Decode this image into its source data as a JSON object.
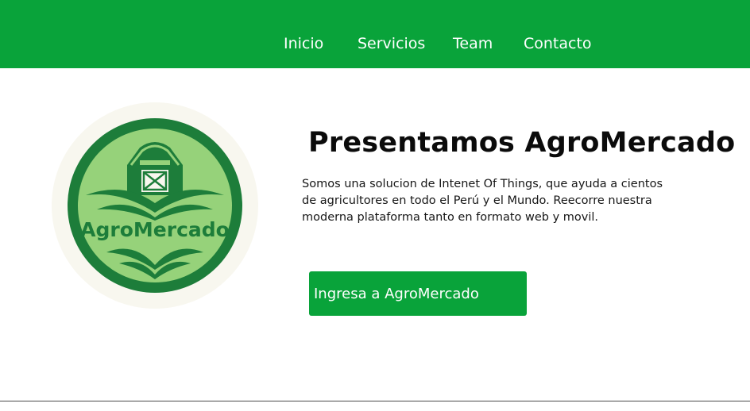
{
  "nav": {
    "links": [
      "Inicio",
      "Servicios",
      "Team",
      "Contacto"
    ]
  },
  "logo": {
    "text": "AgroMercado",
    "colors": {
      "dark": "#1d7d3a",
      "light": "#96d27a",
      "halo": "#f8f7ef"
    }
  },
  "hero": {
    "title": "Presentamos AgroMercado",
    "description": "Somos una solucion de Intenet Of Things, que ayuda a cientos de agricultores en todo el Perú y el Mundo. Reecorre nuestra moderna plataforma tanto en formato web y movil.",
    "cta_label": "Ingresa a AgroMercado"
  },
  "colors": {
    "brand_green": "#09a33a",
    "text": "#0b0b0b",
    "background": "#ffffff"
  }
}
